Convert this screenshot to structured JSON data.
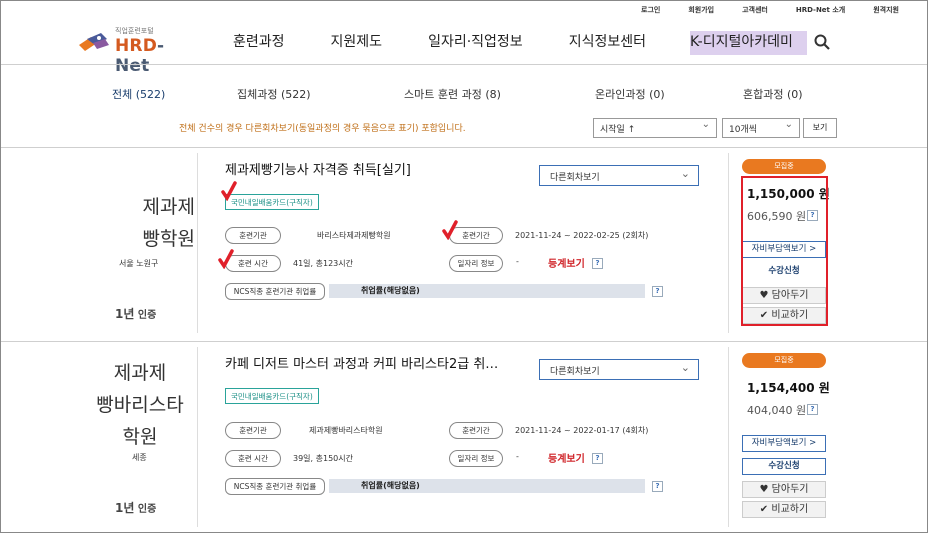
{
  "util_links": [
    "로그인",
    "회원가입",
    "고객센터",
    "HRD-Net 소개",
    "원격지원"
  ],
  "logo": {
    "small": "직업훈련포털",
    "brand_a": "HRD",
    "brand_b": "-Net"
  },
  "gnb": [
    "훈련과정",
    "지원제도",
    "일자리·직업정보",
    "지식정보센터",
    "K-디지털아카데미"
  ],
  "tabs": [
    "전체 (522)",
    "집체과정 (522)",
    "스마트 훈련 과정 (8)",
    "온라인과정 (0)",
    "혼합과정 (0)"
  ],
  "notice": "전체 건수의 경우 다른회차보기(동일과정의 경우 묶음으로 표기) 포함입니다.",
  "sort": {
    "order": "시작일 ↑",
    "count": "10개씩",
    "view_btn": "보기"
  },
  "labels": {
    "rounds": "다른회차보기",
    "inst": "훈련기관",
    "period": "훈련기간",
    "hours": "훈련 시간",
    "job_info": "일자리 정보",
    "ncs": "NCS직종 훈련기관 취업률",
    "stat_link": "등계보기",
    "status": "모집중",
    "self_pay": "자비부담액보기 >",
    "apply": "수강신청",
    "wish": "담아두기",
    "compare": "비교하기",
    "help": "?",
    "cert_a": "1년",
    "cert_b": "인증",
    "dash": "-"
  },
  "courses": [
    {
      "inst_name_1": "제과제",
      "inst_name_2": "빵학원",
      "region": "서울 노원구",
      "title": "제과제빵기능사 자격증 취득[실기]",
      "card_type": "국민내일배움카드(구직자)",
      "inst": "바리스타제과제빵학원",
      "period": "2021-11-24 ~ 2022-02-25 (2회차)",
      "hours": "41일, 총123시간",
      "employment": "취업률(해당없음)",
      "price": "1,150,000 원",
      "self_price": "606,590 원"
    },
    {
      "inst_name_1": "제과제",
      "inst_name_2": "빵바리스타",
      "inst_name_3": "학원",
      "region": "세종",
      "title": "카페 디저트 마스터 과정과 커피 바리스타2급 취…",
      "card_type": "국민내일배움카드(구직자)",
      "inst": "제과제빵바리스타학원",
      "period": "2021-11-24 ~ 2022-01-17 (4회차)",
      "hours": "39일, 총150시간",
      "employment": "취업률(해당없음)",
      "price": "1,154,400 원",
      "self_price": "404,040 원"
    }
  ],
  "colors": {
    "accent": "#e97920",
    "highlight_box": "#e0202a",
    "brand_blue": "#1b3f6e",
    "badge_teal": "#2aa39a"
  }
}
